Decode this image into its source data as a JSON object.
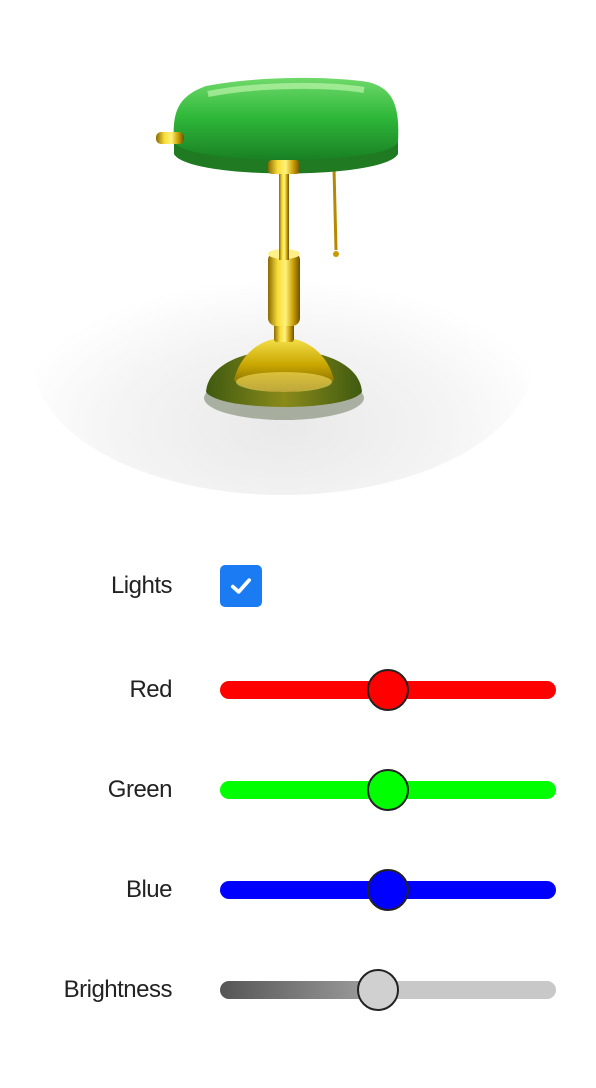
{
  "controls": {
    "lights": {
      "label": "Lights",
      "checked": true
    },
    "sliders": [
      {
        "id": "red",
        "label": "Red",
        "value": 0.5,
        "track_color": "#ff0000",
        "thumb_color": "#ff0000"
      },
      {
        "id": "green",
        "label": "Green",
        "value": 0.5,
        "track_color": "#00ff00",
        "thumb_color": "#00ff00"
      },
      {
        "id": "blue",
        "label": "Blue",
        "value": 0.5,
        "track_color": "#0000ff",
        "thumb_color": "#0000ff"
      },
      {
        "id": "brightness",
        "label": "Brightness",
        "value": 0.47,
        "track_color": "#c8c8c8",
        "track_fill_color": "#555555",
        "thumb_color": "#d0d0d0"
      }
    ]
  },
  "icons": {
    "lamp": "bankers-lamp-icon",
    "check": "checkmark-icon"
  }
}
